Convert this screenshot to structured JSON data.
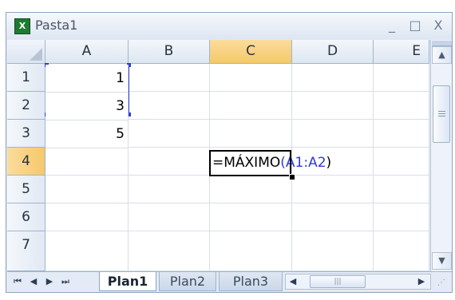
{
  "window": {
    "title": "Pasta1",
    "app_icon_glyph": "X",
    "minimize_glyph": "_",
    "maximize_glyph": "□",
    "close_glyph": "X"
  },
  "columns": [
    "A",
    "B",
    "C",
    "D",
    "E"
  ],
  "selected_column": "C",
  "rows": [
    "1",
    "2",
    "3",
    "4",
    "5",
    "6",
    "7"
  ],
  "selected_row": "4",
  "cells": {
    "A1": "1",
    "A2": "3",
    "A3": "5"
  },
  "formula": {
    "cell": "C4",
    "prefix": "=MÁXIMO",
    "open_paren": "(",
    "range_ref": "A1:A2",
    "close_paren": ")"
  },
  "highlight_colors": {
    "range_border": "#2f3fd0",
    "selected_header": "#f6c86a"
  },
  "sheet_tabs": [
    {
      "label": "Plan1",
      "active": true
    },
    {
      "label": "Plan2",
      "active": false
    },
    {
      "label": "Plan3",
      "active": false
    }
  ],
  "nav_buttons": [
    "first-sheet",
    "previous-sheet",
    "next-sheet",
    "last-sheet"
  ],
  "icons": {
    "nav_first": "⏮",
    "nav_prev": "◀",
    "nav_next": "▶",
    "nav_last": "⏭",
    "scroll_up": "▲",
    "scroll_down": "▼",
    "scroll_left": "◀",
    "scroll_right": "▶",
    "grip": "|||"
  }
}
